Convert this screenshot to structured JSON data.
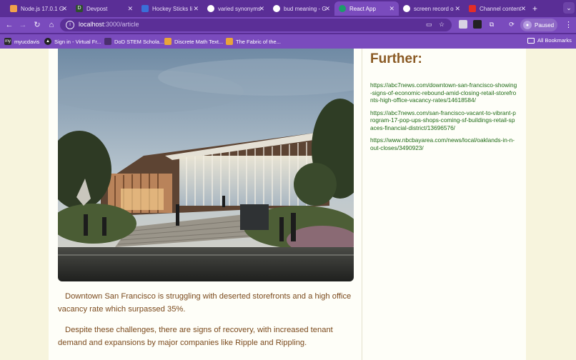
{
  "browser": {
    "tabs": [
      {
        "title": "Node.js 17.0.1 G",
        "favicon_color": "#f2a24a"
      },
      {
        "title": "Devpost",
        "favicon_color": "#2f4f2f"
      },
      {
        "title": "Hockey Sticks li",
        "favicon_color": "#3a6fd8"
      },
      {
        "title": "varied synonyms",
        "favicon_color": "#ffffff"
      },
      {
        "title": "bud meaning - G",
        "favicon_color": "#ffffff"
      },
      {
        "title": "React App",
        "favicon_color": "#1d9c6a"
      },
      {
        "title": "screen record o",
        "favicon_color": "#ffffff"
      },
      {
        "title": "Channel content",
        "favicon_color": "#e52d27"
      }
    ],
    "url_host": "localhost",
    "url_path": ":3000/article",
    "profile_label": "Paused",
    "bookmarks": [
      {
        "label": "myucdavis",
        "icon_color": "#2b2b2b",
        "icon_text": "my"
      },
      {
        "label": "Sign in - Virtual Fr...",
        "icon_color": "#222222",
        "icon_text": "▲"
      },
      {
        "label": "DoD STEM Schola...",
        "icon_color": "#4a2f6e",
        "icon_text": ""
      },
      {
        "label": "Discrete Math Text...",
        "icon_color": "#e8a43a",
        "icon_text": ""
      },
      {
        "label": "The Fabric of the...",
        "icon_color": "#e8a43a",
        "icon_text": ""
      }
    ],
    "all_bookmarks_label": "All Bookmarks"
  },
  "article": {
    "paragraphs": [
      "Downtown San Francisco is struggling with deserted storefronts and a high office vacancy rate which surpassed 35%.",
      "Despite these challenges, there are signs of recovery, with increased tenant demand and expansions by major companies like Ripple and Rippling."
    ]
  },
  "sidebar": {
    "heading": "Further:",
    "links": [
      "https://abc7news.com/downtown-san-francisco-showing-signs-of-economic-rebound-amid-closing-retail-storefronts-high-office-vacancy-rates/14618584/",
      "https://abc7news.com/san-francisco-vacant-to-vibrant-program-17-pop-ups-shops-coming-sf-buildings-retail-spaces-financial-district/13696576/",
      "https://www.nbcbayarea.com/news/local/oaklands-in-n-out-closes/3490923/"
    ]
  },
  "colors": {
    "chrome": "#5a2e96",
    "toolbar": "#7a4bbd",
    "page_bg": "#f7f4dd",
    "paragraph_text": "#7b4a1d",
    "heading": "#8a5a24",
    "link": "#1f6b16"
  }
}
